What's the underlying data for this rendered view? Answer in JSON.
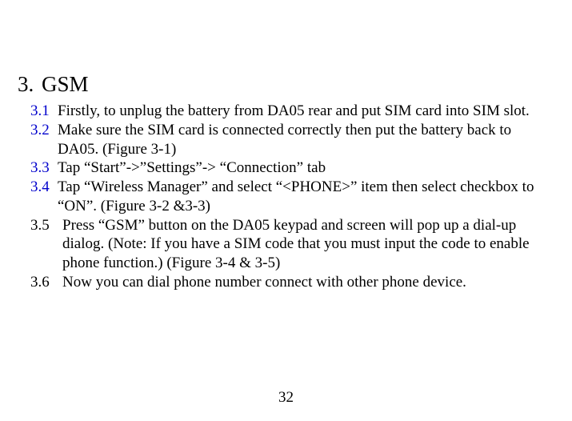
{
  "heading": {
    "number": "3.",
    "title": "GSM"
  },
  "items": [
    {
      "num": "3.1",
      "blue": true,
      "wide": false,
      "text": "Firstly, to unplug the battery from DA05 rear and put SIM card into SIM slot."
    },
    {
      "num": "3.2",
      "blue": true,
      "wide": false,
      "text": "Make sure the SIM card is connected correctly then put the battery back to DA05. (Figure 3-1)"
    },
    {
      "num": "3.3",
      "blue": true,
      "wide": false,
      "text": "Tap “Start”->”Settings”-> “Connection” tab"
    },
    {
      "num": "3.4",
      "blue": true,
      "wide": false,
      "text": "Tap “Wireless Manager” and select “<PHONE>” item then select checkbox to “ON”. (Figure 3-2 &3-3)"
    },
    {
      "num": "3.5",
      "blue": false,
      "wide": true,
      "text": "Press “GSM” button on the DA05 keypad and screen will pop up a dial-up dialog. (Note: If you have a SIM code that you must input the code to enable phone function.) (Figure 3-4 & 3-5)"
    },
    {
      "num": "3.6",
      "blue": false,
      "wide": true,
      "text": "Now you can dial phone number connect with other phone device."
    }
  ],
  "page_number": "32"
}
